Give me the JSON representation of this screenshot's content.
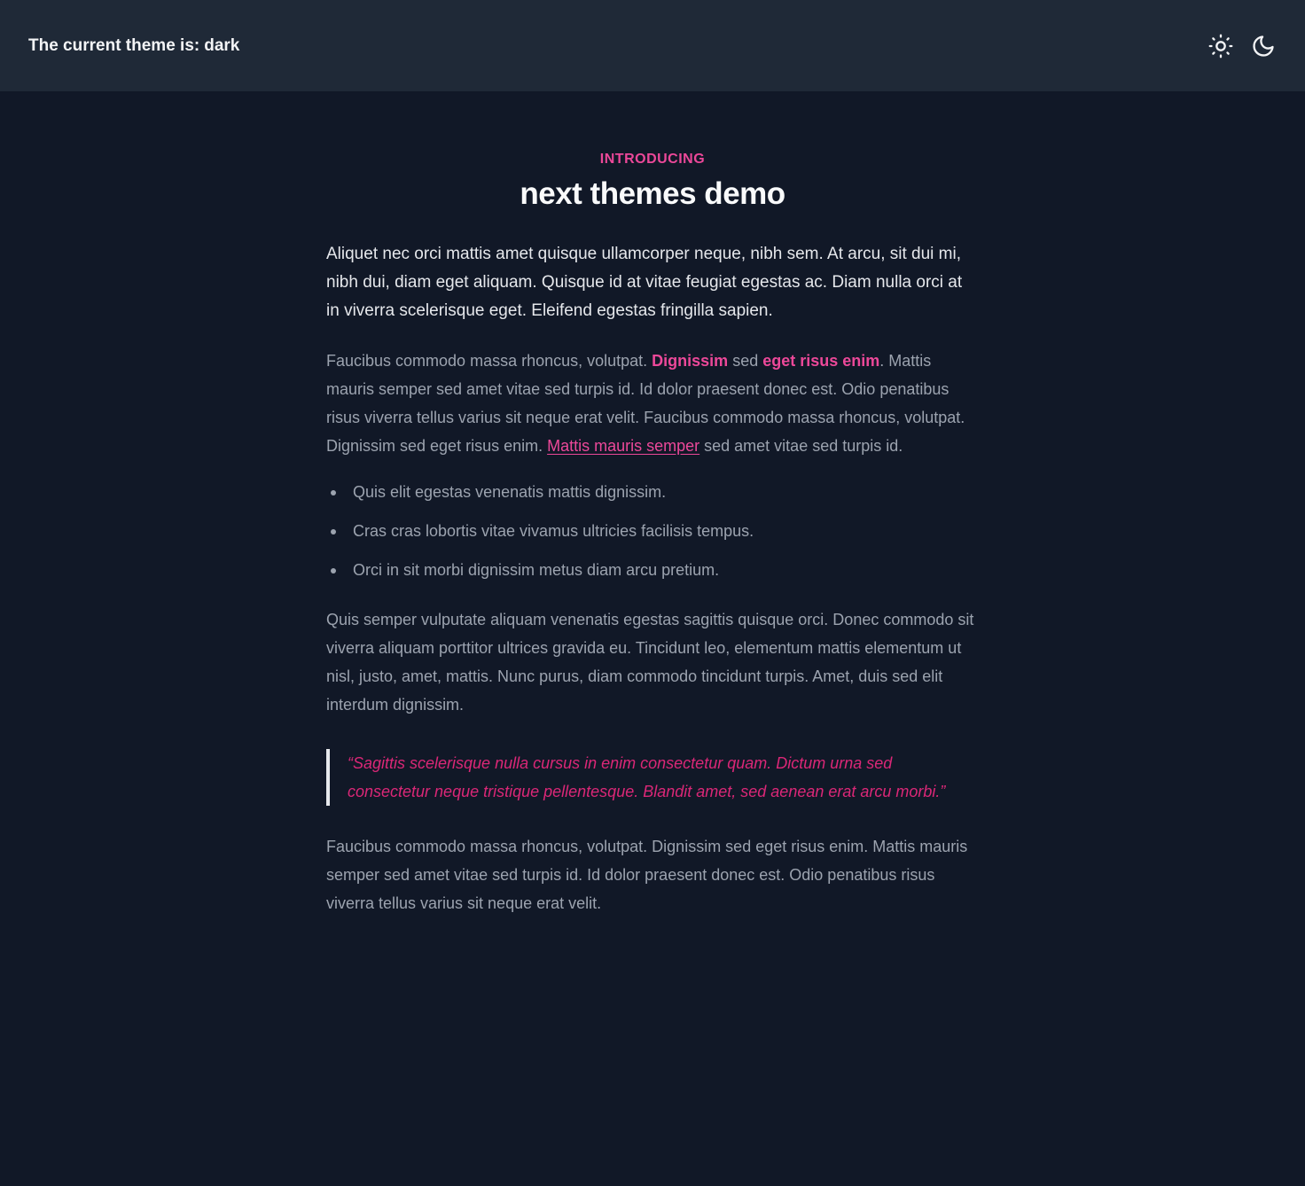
{
  "header": {
    "theme_prefix": "The current theme is:",
    "theme_value": "dark",
    "icons": [
      "sun-icon",
      "moon-icon"
    ]
  },
  "article": {
    "eyebrow": "Introducing",
    "title": "next themes demo",
    "lead": "Aliquet nec orci mattis amet quisque ullamcorper neque, nibh sem. At arcu, sit dui mi, nibh dui, diam eget aliquam. Quisque id at vitae feugiat egestas ac. Diam nulla orci at in viverra scelerisque eget. Eleifend egestas fringilla sapien.",
    "p1": {
      "seg1": "Faucibus commodo massa rhoncus, volutpat. ",
      "strong1": "Dignissim",
      "seg2": " sed ",
      "strong2": "eget risus enim",
      "seg3": ". Mattis mauris semper sed amet vitae sed turpis id. Id dolor praesent donec est. Odio penatibus risus viverra tellus varius sit neque erat velit. Faucibus commodo massa rhoncus, volutpat. Dignissim sed eget risus enim. ",
      "link": "Mattis mauris semper",
      "seg4": " sed amet vitae sed turpis id."
    },
    "bullets": [
      "Quis elit egestas venenatis mattis dignissim.",
      "Cras cras lobortis vitae vivamus ultricies facilisis tempus.",
      "Orci in sit morbi dignissim metus diam arcu pretium."
    ],
    "p2": "Quis semper vulputate aliquam venenatis egestas sagittis quisque orci. Donec commodo sit viverra aliquam porttitor ultrices gravida eu. Tincidunt leo, elementum mattis elementum ut nisl, justo, amet, mattis. Nunc purus, diam commodo tincidunt turpis. Amet, duis sed elit interdum dignissim.",
    "quote": "“Sagittis scelerisque nulla cursus in enim consectetur quam. Dictum urna sed consectetur neque tristique pellentesque. Blandit amet, sed aenean erat arcu morbi.”",
    "p3": "Faucibus commodo massa rhoncus, volutpat. Dignissim sed eget risus enim. Mattis mauris semper sed amet vitae sed turpis id. Id dolor praesent donec est. Odio penatibus risus viverra tellus varius sit neque erat velit."
  },
  "colors": {
    "background": "#111827",
    "header_bg": "#1f2937",
    "accent": "#ec4899",
    "quote": "#db2777"
  }
}
